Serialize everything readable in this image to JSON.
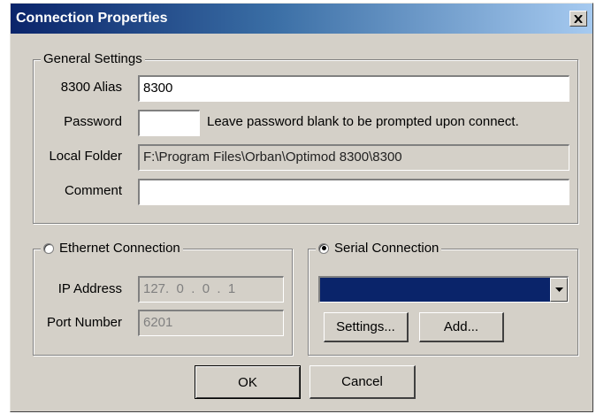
{
  "window": {
    "title": "Connection Properties",
    "close_glyph": "✕"
  },
  "general": {
    "legend": "General Settings",
    "alias_label": "8300 Alias",
    "alias_value": "8300",
    "password_label": "Password",
    "password_value": "",
    "password_hint": "Leave password blank to be prompted upon connect.",
    "folder_label": "Local Folder",
    "folder_value": "F:\\Program Files\\Orban\\Optimod 8300\\8300",
    "comment_label": "Comment",
    "comment_value": ""
  },
  "ethernet": {
    "legend": "Ethernet Connection",
    "selected": false,
    "ip_label": "IP Address",
    "ip_value": "127.  0  .  0  .  1",
    "port_label": "Port Number",
    "port_value": "6201"
  },
  "serial": {
    "legend": "Serial Connection",
    "selected": true,
    "port_selected": "",
    "settings_label": "Settings...",
    "add_label": "Add..."
  },
  "footer": {
    "ok_label": "OK",
    "cancel_label": "Cancel"
  },
  "colors": {
    "title_bar": "#0a246a",
    "dialog_face": "#d4d0c8",
    "combo_selection": "#0a246a"
  },
  "icons": {
    "close": "close-icon",
    "dropdown": "chevron-down-icon"
  }
}
